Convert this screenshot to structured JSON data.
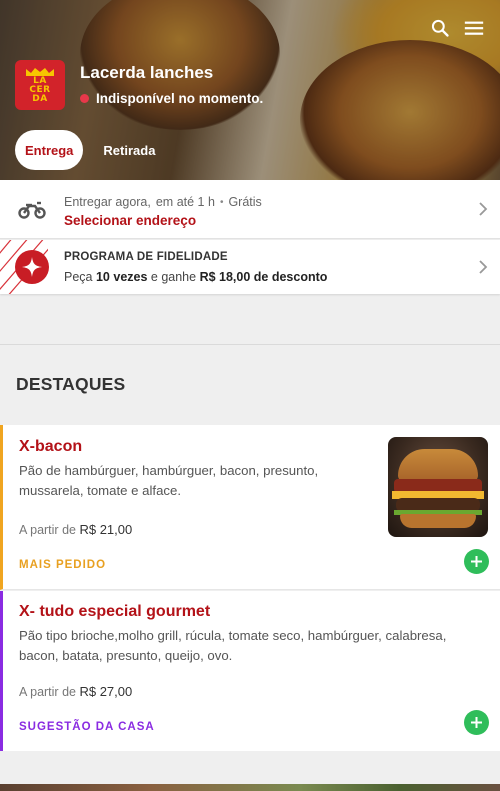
{
  "header": {
    "store_name": "Lacerda lanches",
    "status_text": "Indisponível no momento.",
    "status_color": "#e8384a",
    "logo_text": "LA CER DA",
    "icons": [
      "search-icon",
      "menu-icon"
    ]
  },
  "mode_toggle": {
    "options": [
      {
        "label": "Entrega",
        "active": true
      },
      {
        "label": "Retirada",
        "active": false
      }
    ]
  },
  "delivery": {
    "icon": "motorcycle-icon",
    "when": "Entregar agora,",
    "eta": "em até 1 h",
    "separator": "•",
    "fee": "Grátis",
    "action": "Selecionar endereço"
  },
  "loyalty": {
    "icon": "star-badge-icon",
    "title": "PROGRAMA DE FIDELIDADE",
    "desc_prefix": "Peça",
    "desc_count": "10 vezes",
    "desc_middle": "e ganhe",
    "desc_reward": "R$ 18,00 de desconto"
  },
  "section": {
    "title": "DESTAQUES"
  },
  "products": [
    {
      "name": "X-bacon",
      "description": "Pão de hambúrguer, hambúrguer, bacon, presunto, mussarela, tomate e alface.",
      "price_prefix": "A partir de",
      "price": "R$ 21,00",
      "tag": "MAIS PEDIDO",
      "tag_color": "#e8a020"
    },
    {
      "name": "X- tudo especial gourmet",
      "description": "Pão tipo brioche,molho grill, rúcula, tomate seco, hambúrguer, calabresa, bacon, batata, presunto, queijo, ovo.",
      "price_prefix": "A partir de",
      "price": "R$ 27,00",
      "tag": "SUGESTÃO DA CASA",
      "tag_color": "#8a2be2"
    }
  ],
  "colors": {
    "brand_red": "#b31218",
    "add_green": "#2fbd5a"
  }
}
